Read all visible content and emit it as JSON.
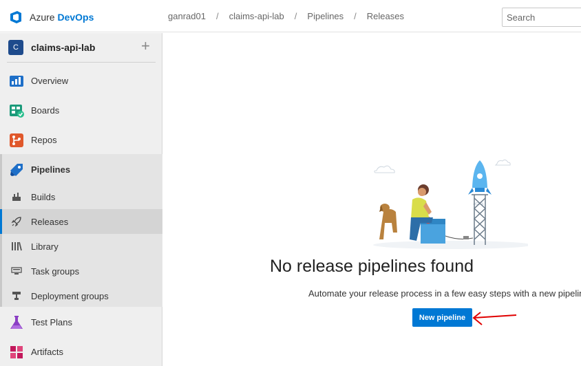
{
  "brand": {
    "prefix": "Azure ",
    "name": "DevOps"
  },
  "breadcrumb": [
    "ganrad01",
    "claims-api-lab",
    "Pipelines",
    "Releases"
  ],
  "search": {
    "placeholder": "Search"
  },
  "project": {
    "initial": "C",
    "name": "claims-api-lab",
    "add_symbol": "+"
  },
  "nav": {
    "overview": "Overview",
    "boards": "Boards",
    "repos": "Repos",
    "pipelines": "Pipelines",
    "builds": "Builds",
    "releases": "Releases",
    "library": "Library",
    "task_groups": "Task groups",
    "deployment_groups": "Deployment groups",
    "test_plans": "Test Plans",
    "artifacts": "Artifacts"
  },
  "empty_state": {
    "title": "No release pipelines found",
    "subtitle": "Automate your release process in a few easy steps with a new pipeline",
    "button": "New pipeline"
  },
  "colors": {
    "accent": "#0078d4",
    "annotation_arrow": "#e00000"
  }
}
